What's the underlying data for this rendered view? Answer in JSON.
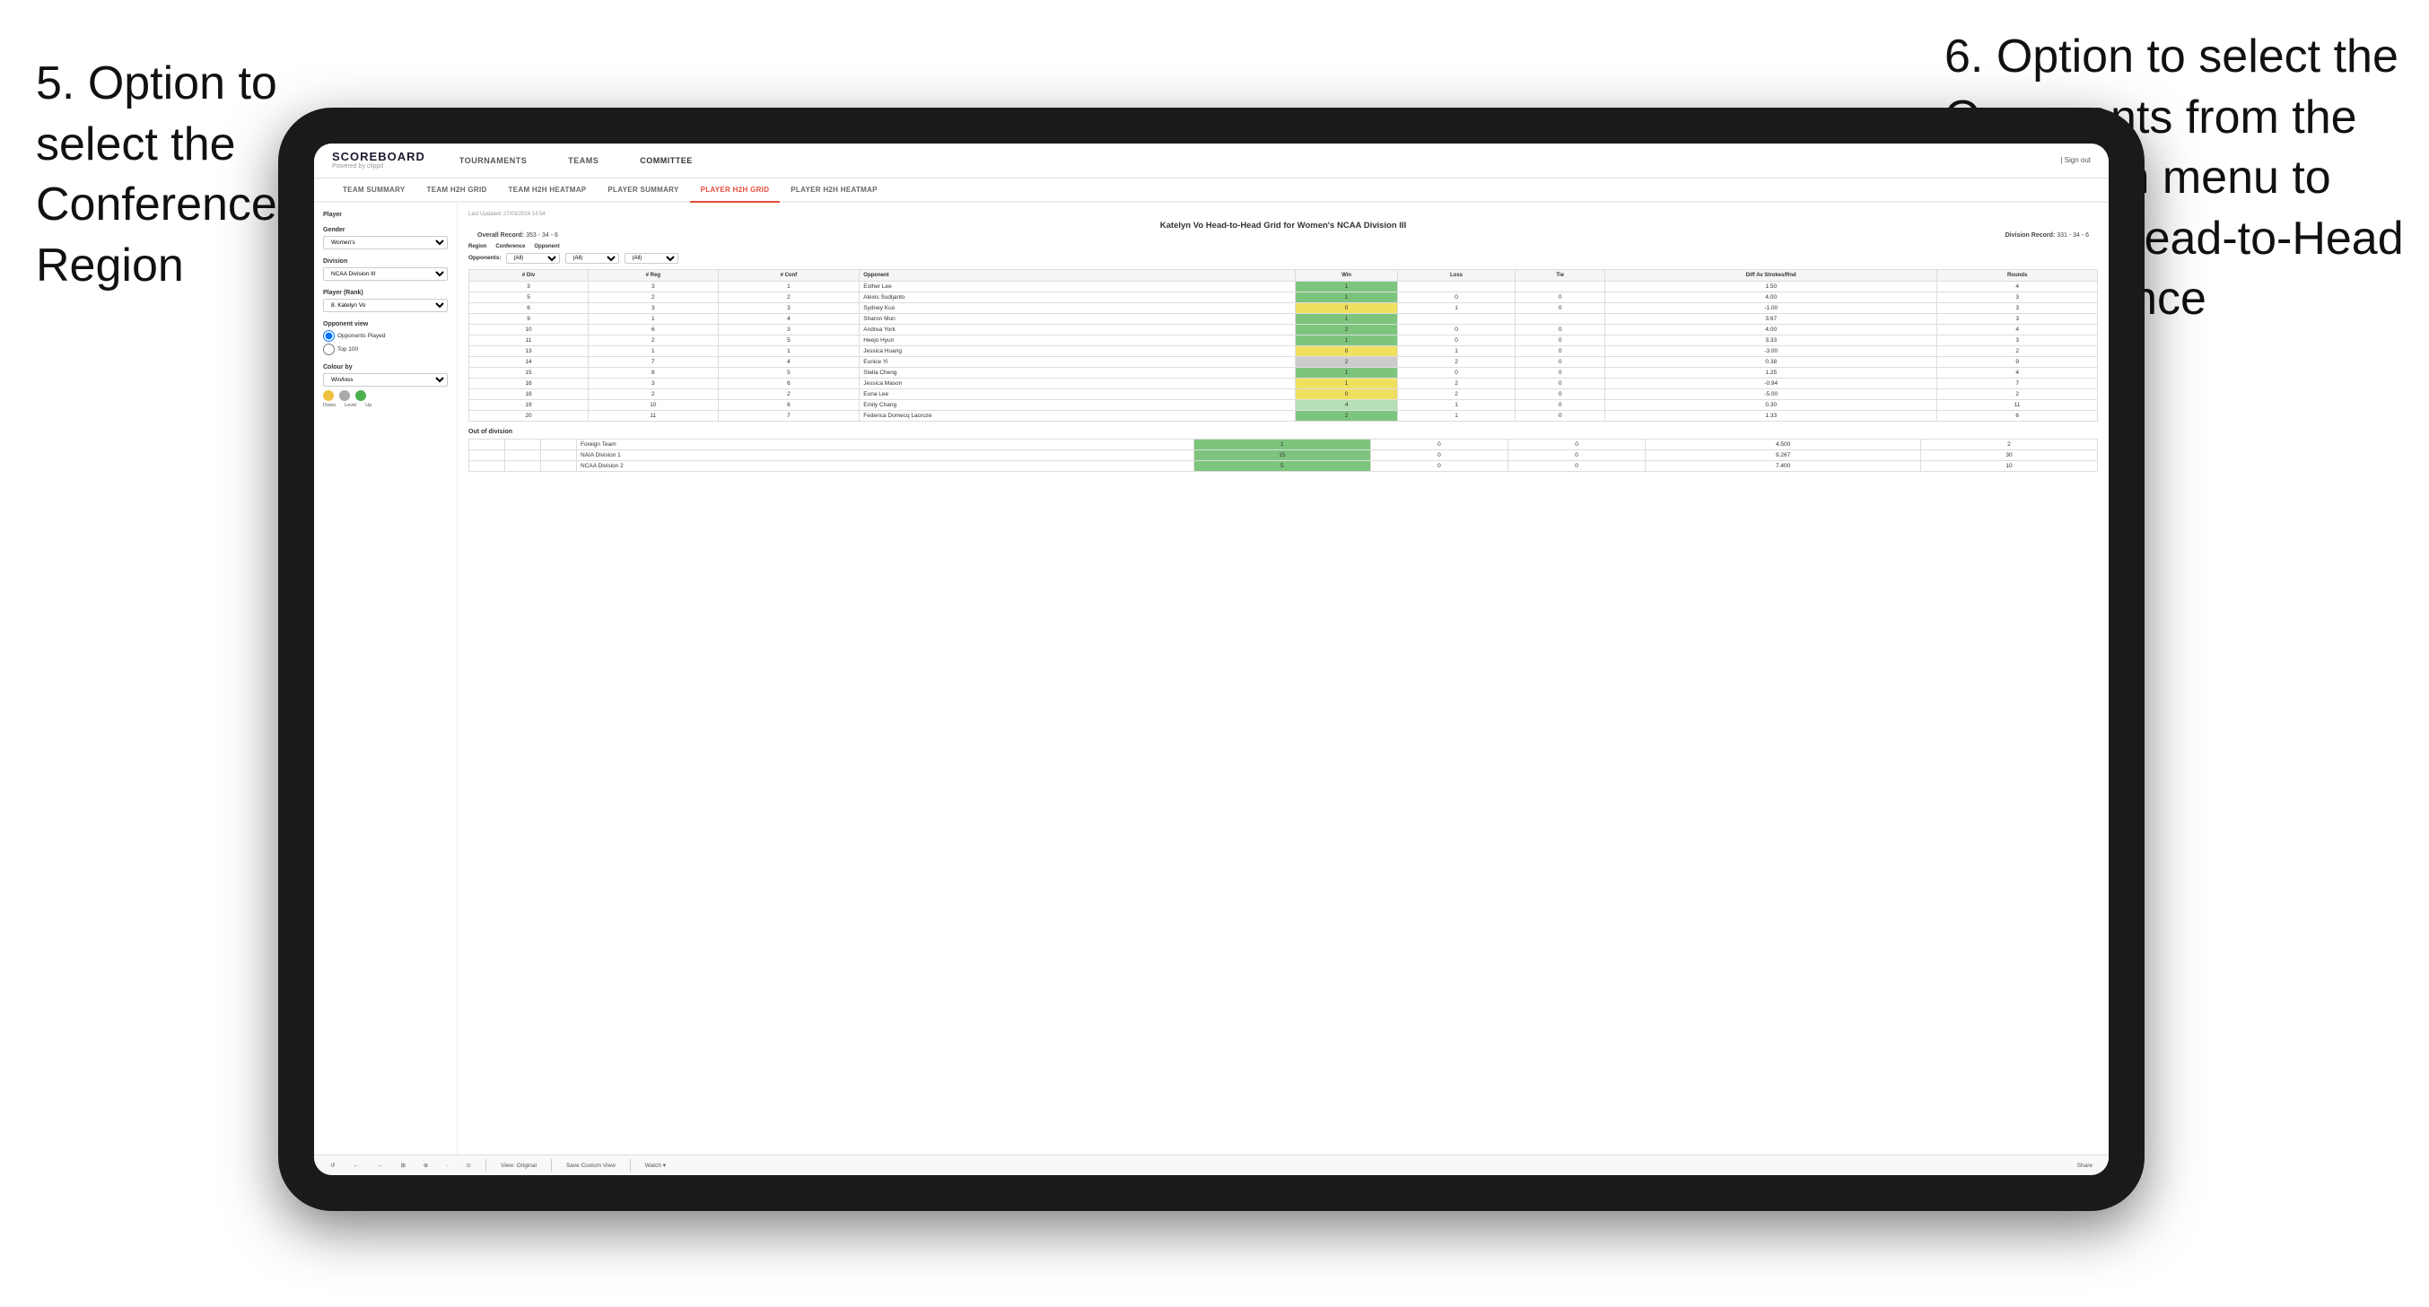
{
  "annotations": {
    "left_title": "5. Option to select the Conference and Region",
    "right_title": "6. Option to select the Opponents from the dropdown menu to see the Head-to-Head performance"
  },
  "nav": {
    "logo": "SCOREBOARD",
    "logo_sub": "Powered by clippd",
    "items": [
      "TOURNAMENTS",
      "TEAMS",
      "COMMITTEE"
    ],
    "sign_out": "Sign out",
    "user_icon": "| "
  },
  "sub_nav": {
    "items": [
      "TEAM SUMMARY",
      "TEAM H2H GRID",
      "TEAM H2H HEATMAP",
      "PLAYER SUMMARY",
      "PLAYER H2H GRID",
      "PLAYER H2H HEATMAP"
    ],
    "active": "PLAYER H2H GRID"
  },
  "sidebar": {
    "player_label": "Player",
    "gender_label": "Gender",
    "gender_value": "Women's",
    "division_label": "Division",
    "division_value": "NCAA Division III",
    "player_rank_label": "Player (Rank)",
    "player_rank_value": "8. Katelyn Vo",
    "opponent_view_label": "Opponent view",
    "opponent_view_options": [
      "Opponents Played",
      "Top 100"
    ],
    "colour_by_label": "Colour by",
    "colour_by_value": "Win/loss",
    "colour_labels": [
      "Down",
      "Level",
      "Up"
    ]
  },
  "panel": {
    "last_updated": "Last Updated: 27/03/2024 14:54",
    "title": "Katelyn Vo Head-to-Head Grid for Women's NCAA Division III",
    "overall_record_label": "Overall Record:",
    "overall_record_value": "353 - 34 - 6",
    "division_record_label": "Division Record:",
    "division_record_value": "331 - 34 - 6",
    "filter": {
      "region_label": "Region",
      "conference_label": "Conference",
      "opponent_label": "Opponent",
      "opponents_label": "Opponents:",
      "region_value": "(All)",
      "conference_value": "(All)",
      "opponent_value": "(All)"
    },
    "table": {
      "headers": [
        "# Div",
        "# Reg",
        "# Conf",
        "Opponent",
        "Win",
        "Loss",
        "Tie",
        "Diff Av Strokes/Rnd",
        "Rounds"
      ],
      "rows": [
        {
          "div": "3",
          "reg": "3",
          "conf": "1",
          "opponent": "Esther Lee",
          "win": "1",
          "loss": "",
          "tie": "",
          "diff": "1.50",
          "rounds": "4",
          "win_color": "green"
        },
        {
          "div": "5",
          "reg": "2",
          "conf": "2",
          "opponent": "Alexis Sudijanto",
          "win": "1",
          "loss": "0",
          "tie": "0",
          "diff": "4.00",
          "rounds": "3",
          "win_color": "green"
        },
        {
          "div": "6",
          "reg": "3",
          "conf": "3",
          "opponent": "Sydney Kuo",
          "win": "0",
          "loss": "1",
          "tie": "0",
          "diff": "-1.00",
          "rounds": "3",
          "win_color": "yellow"
        },
        {
          "div": "9",
          "reg": "1",
          "conf": "4",
          "opponent": "Sharon Mun",
          "win": "1",
          "loss": "",
          "tie": "",
          "diff": "3.67",
          "rounds": "3",
          "win_color": "green"
        },
        {
          "div": "10",
          "reg": "6",
          "conf": "3",
          "opponent": "Andrea York",
          "win": "2",
          "loss": "0",
          "tie": "0",
          "diff": "4.00",
          "rounds": "4",
          "win_color": "green"
        },
        {
          "div": "11",
          "reg": "2",
          "conf": "5",
          "opponent": "Heejo Hyun",
          "win": "1",
          "loss": "0",
          "tie": "0",
          "diff": "3.33",
          "rounds": "3",
          "win_color": "green"
        },
        {
          "div": "13",
          "reg": "1",
          "conf": "1",
          "opponent": "Jessica Huang",
          "win": "0",
          "loss": "1",
          "tie": "0",
          "diff": "-3.00",
          "rounds": "2",
          "win_color": "yellow"
        },
        {
          "div": "14",
          "reg": "7",
          "conf": "4",
          "opponent": "Eunice Yi",
          "win": "2",
          "loss": "2",
          "tie": "0",
          "diff": "0.38",
          "rounds": "9",
          "win_color": "gray"
        },
        {
          "div": "15",
          "reg": "8",
          "conf": "5",
          "opponent": "Stella Cheng",
          "win": "1",
          "loss": "0",
          "tie": "0",
          "diff": "1.25",
          "rounds": "4",
          "win_color": "green"
        },
        {
          "div": "16",
          "reg": "3",
          "conf": "6",
          "opponent": "Jessica Mason",
          "win": "1",
          "loss": "2",
          "tie": "0",
          "diff": "-0.94",
          "rounds": "7",
          "win_color": "yellow"
        },
        {
          "div": "18",
          "reg": "2",
          "conf": "2",
          "opponent": "Euna Lee",
          "win": "0",
          "loss": "2",
          "tie": "0",
          "diff": "-5.00",
          "rounds": "2",
          "win_color": "yellow"
        },
        {
          "div": "19",
          "reg": "10",
          "conf": "6",
          "opponent": "Emily Chang",
          "win": "4",
          "loss": "1",
          "tie": "0",
          "diff": "0.30",
          "rounds": "11",
          "win_color": "light-green"
        },
        {
          "div": "20",
          "reg": "11",
          "conf": "7",
          "opponent": "Federica Domecq Lacroze",
          "win": "2",
          "loss": "1",
          "tie": "0",
          "diff": "1.33",
          "rounds": "6",
          "win_color": "green"
        }
      ]
    },
    "out_of_division_label": "Out of division",
    "out_of_division_rows": [
      {
        "opponent": "Foreign Team",
        "win": "1",
        "loss": "0",
        "tie": "0",
        "diff": "4.500",
        "rounds": "2"
      },
      {
        "opponent": "NAIA Division 1",
        "win": "15",
        "loss": "0",
        "tie": "0",
        "diff": "9.267",
        "rounds": "30"
      },
      {
        "opponent": "NCAA Division 2",
        "win": "5",
        "loss": "0",
        "tie": "0",
        "diff": "7.400",
        "rounds": "10"
      }
    ]
  },
  "toolbar": {
    "buttons": [
      "↺",
      "←",
      "→",
      "⊞",
      "⊕",
      "·",
      "⊙"
    ],
    "view_original": "View: Original",
    "save_custom": "Save Custom View",
    "watch": "Watch ▾",
    "share": "Share"
  }
}
